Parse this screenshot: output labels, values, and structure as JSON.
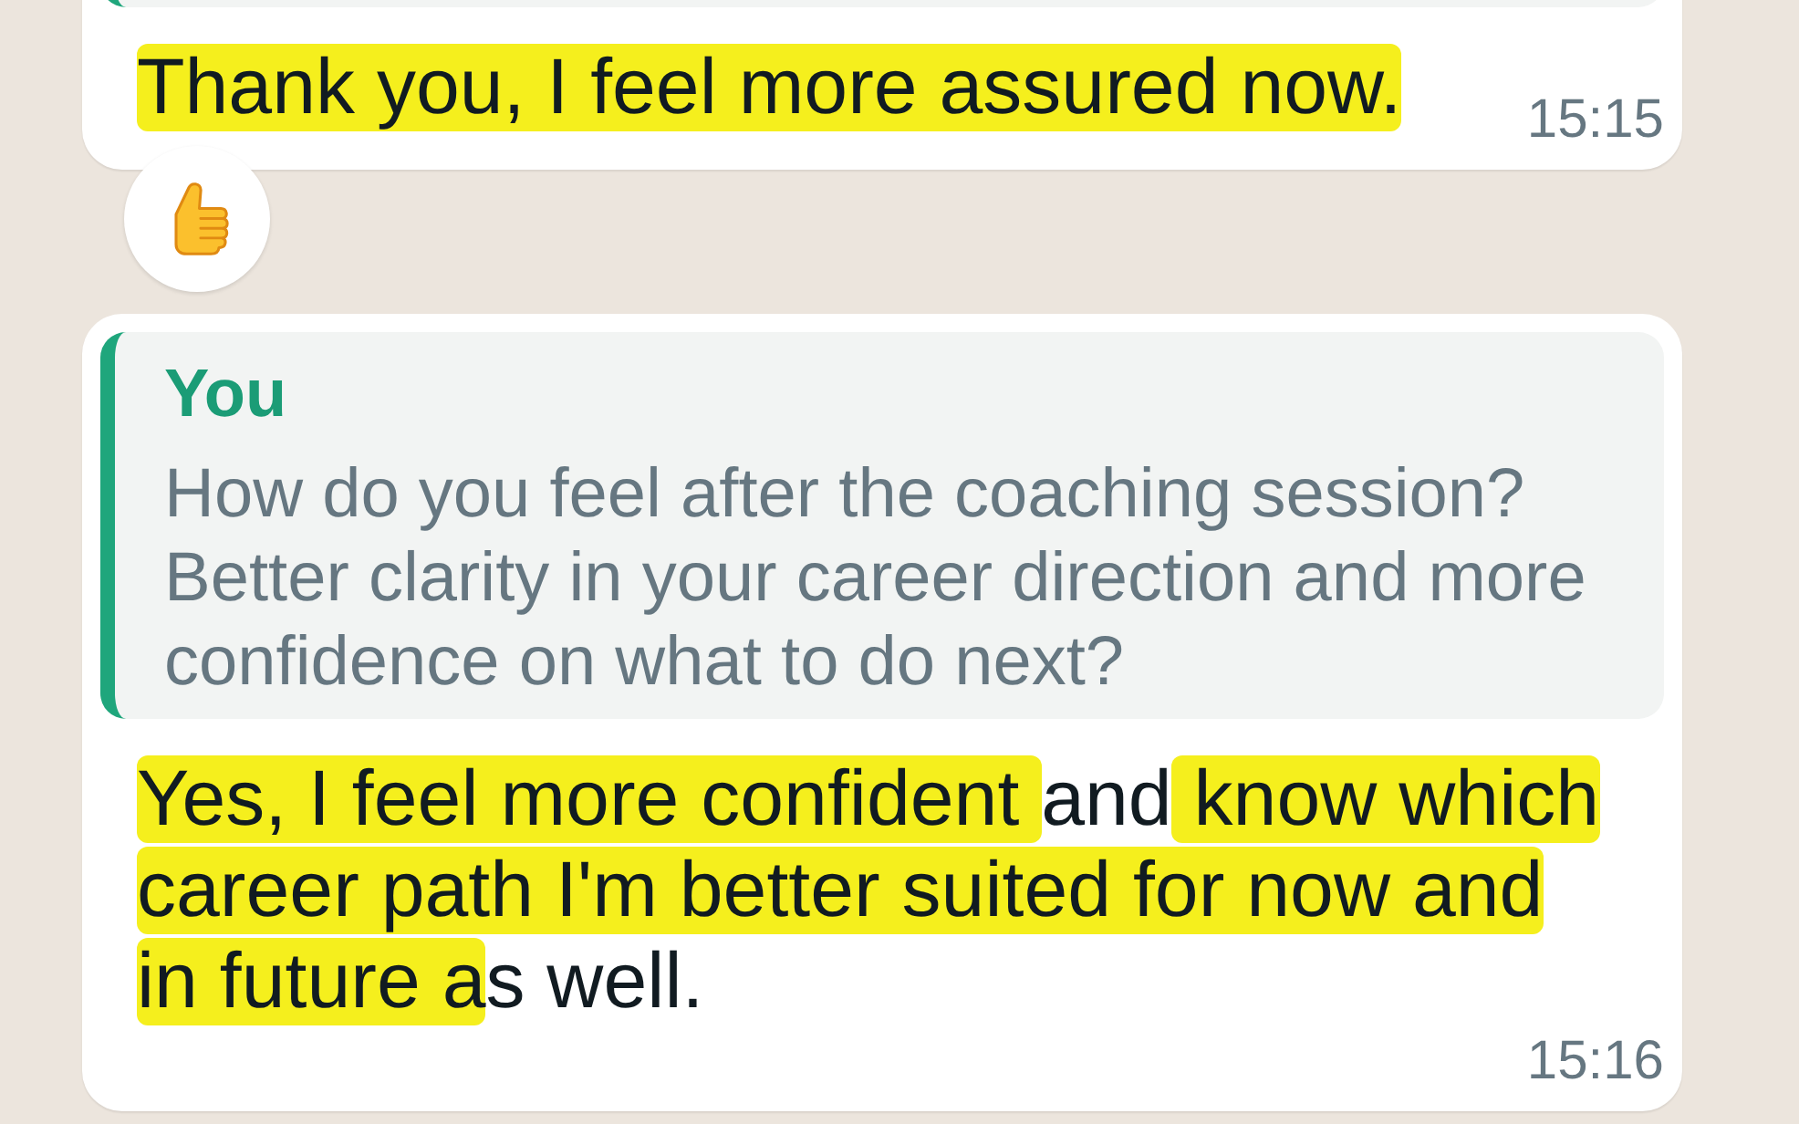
{
  "messages": [
    {
      "quote": {
        "cut_off": true
      },
      "segments": [
        {
          "text": "Thank you, I feel more assured now.",
          "highlighted": true
        }
      ],
      "time": "15:15",
      "reaction": {
        "kind": "thumbs_up"
      }
    },
    {
      "quote": {
        "author": "You",
        "text": "How do you feel after the coaching session? Better clarity in your career direction and more confidence on what to do next?"
      },
      "segments": [
        {
          "text": "Yes, I feel more confident ",
          "highlighted": true
        },
        {
          "text": "and",
          "highlighted": false
        },
        {
          "text": " know which career path I'm better suited for now and in future a",
          "highlighted": true
        },
        {
          "text": "s well.",
          "highlighted": false
        }
      ],
      "time": "15:16"
    }
  ]
}
